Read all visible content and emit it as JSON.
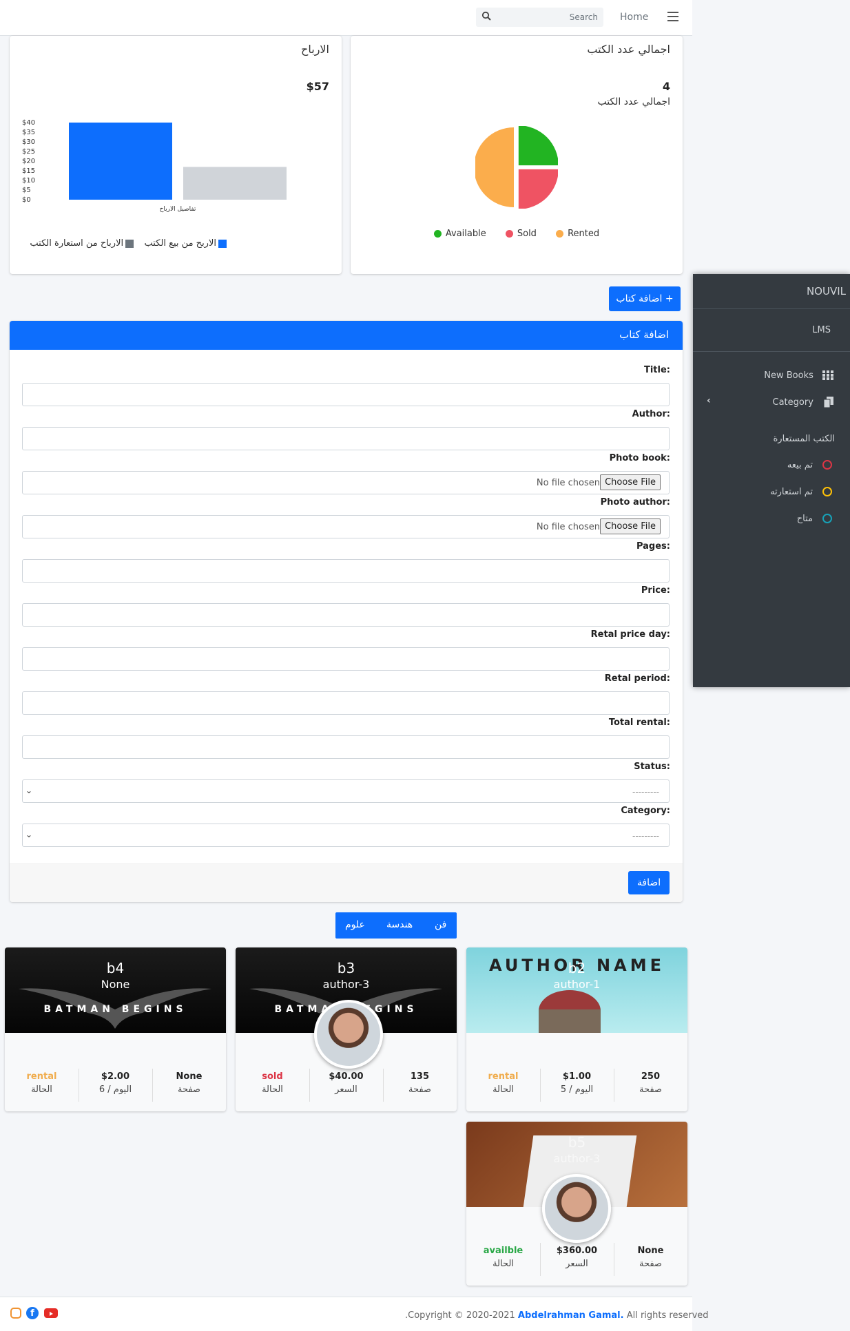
{
  "topbar": {
    "search_placeholder": "Search",
    "home": "Home"
  },
  "profit_card": {
    "title": "الارباح",
    "value": "$57",
    "chart_axis_title": "تفاصيل الارباح",
    "legend": [
      {
        "label": "الاربح من بيع الكتب",
        "color": "#0d6efd"
      },
      {
        "label": "الارباح من استعارة الكتب",
        "color": "#6c757d"
      }
    ]
  },
  "books_card": {
    "title": "اجمالي عدد الكتب",
    "value": "4",
    "subtitle": "اجمالي عدد الكتب",
    "legend": [
      {
        "label": "Available",
        "color": "#22b422"
      },
      {
        "label": "Sold",
        "color": "#ef5363"
      },
      {
        "label": "Rented",
        "color": "#fbad4c"
      }
    ]
  },
  "chart_data": [
    {
      "type": "bar",
      "categories": [
        "تفاصيل الارباح"
      ],
      "series": [
        {
          "name": "الاربح من بيع الكتب",
          "values": [
            40
          ]
        },
        {
          "name": "الارباح من استعارة الكتب",
          "values": [
            17
          ]
        }
      ],
      "xlabel": "تفاصيل الارباح",
      "ylim": [
        0,
        40
      ],
      "yticks": [
        "$0",
        "$5",
        "$10",
        "$15",
        "$20",
        "$25",
        "$30",
        "$35",
        "$40"
      ],
      "legend_position": "bottom"
    },
    {
      "type": "pie",
      "labels": [
        "Available",
        "Sold",
        "Rented"
      ],
      "values": [
        1,
        1,
        2
      ],
      "colors": [
        "#22b422",
        "#ef5363",
        "#fbad4c"
      ],
      "legend_position": "bottom"
    }
  ],
  "add_book_toggle": "+ اضافة كتاب",
  "form": {
    "header": "اضافة كتاب",
    "labels": {
      "title": ":Title",
      "author": ":Author",
      "photo_book": ":Photo book",
      "photo_author": ":Photo author",
      "pages": ":Pages",
      "price": ":Price",
      "retal_price_day": ":Retal price day",
      "retal_period": ":Retal period",
      "total_rental": ":Total rental",
      "status": ":Status",
      "category": ":Category"
    },
    "file_button": "Choose File",
    "file_none": "No file chosen",
    "select_placeholder": "---------",
    "submit": "اضافة"
  },
  "sidebar": {
    "brand": "NOUVIL",
    "sub": "LMS",
    "items": [
      {
        "label": "New Books",
        "icon": "grid-icon"
      },
      {
        "label": "Category",
        "icon": "copy-icon"
      }
    ],
    "section": "الكتب المستعارة",
    "status_items": [
      {
        "label": "تم بيعه",
        "color": "#dc3545"
      },
      {
        "label": "تم استعارته",
        "color": "#ffc107"
      },
      {
        "label": "متاح",
        "color": "#17a2b8"
      }
    ]
  },
  "tabs": [
    "فن",
    "هندسة",
    "علوم"
  ],
  "books": [
    {
      "name": "b4",
      "author": "None",
      "stats": [
        {
          "value": "rental",
          "label": "الحالة",
          "color": "#f0ad4e"
        },
        {
          "value": "$2.00",
          "label": "6 / اليوم"
        },
        {
          "value": "None",
          "label": "صفحة"
        }
      ]
    },
    {
      "name": "b3",
      "author": "author-3",
      "stats": [
        {
          "value": "sold",
          "label": "الحالة",
          "color": "#dc3545"
        },
        {
          "value": "$40.00",
          "label": "السعر"
        },
        {
          "value": "135",
          "label": "صفحة"
        }
      ]
    },
    {
      "name": "b2",
      "author": "author-1",
      "cover_text": "AUTHOR NAME",
      "stats": [
        {
          "value": "rental",
          "label": "الحالة",
          "color": "#f0ad4e"
        },
        {
          "value": "$1.00",
          "label": "5 / اليوم"
        },
        {
          "value": "250",
          "label": "صفحة"
        }
      ]
    },
    {
      "name": "b5",
      "author": "author-3",
      "stats": [
        {
          "value": "availble",
          "label": "الحالة",
          "color": "#28a745"
        },
        {
          "value": "$360.00",
          "label": "السعر"
        },
        {
          "value": "None",
          "label": "صفحة"
        }
      ]
    }
  ],
  "cover_texts": {
    "batman": "BATMAN BEGINS"
  },
  "footer": {
    "prefix": ".Copyright © 2020-2021 ",
    "author": "Abdelrahman Gamal.",
    "suffix": " All rights reserved"
  }
}
